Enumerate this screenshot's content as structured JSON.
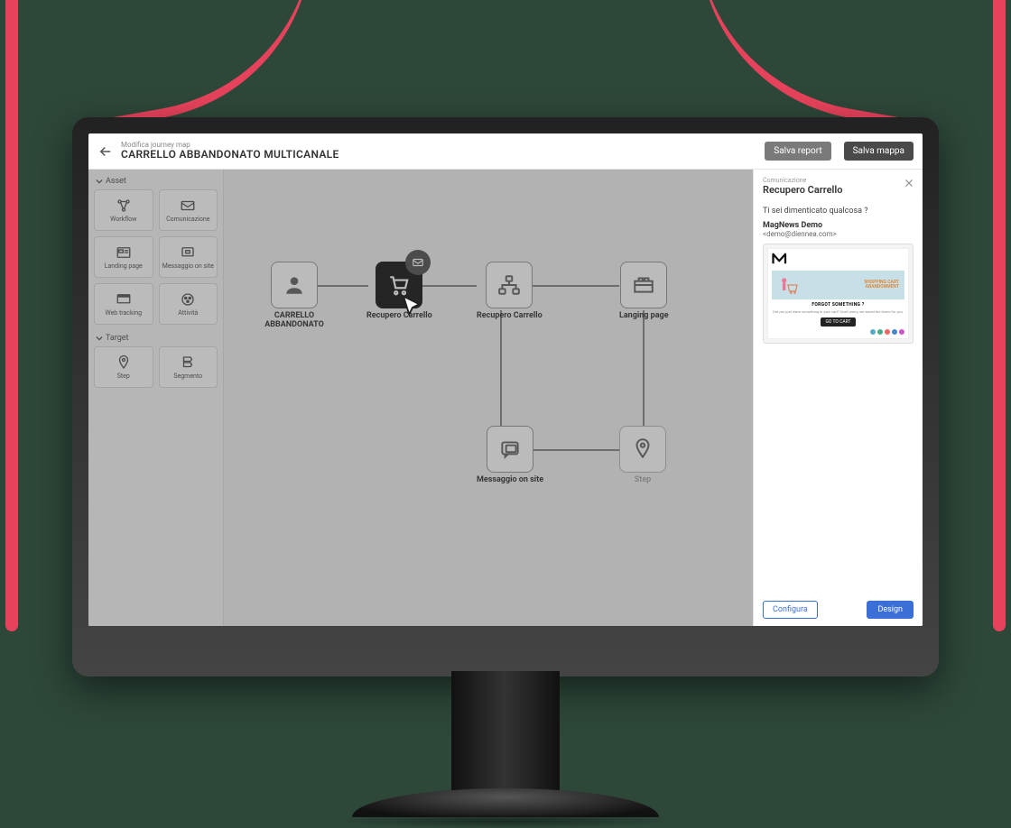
{
  "header": {
    "breadcrumb": "Modifica journey map",
    "title": "CARRELLO ABBANDONATO MULTICANALE",
    "save_report": "Salva report",
    "save_map": "Salva mappa"
  },
  "sidebar": {
    "sections": [
      {
        "title": "Asset",
        "tiles": [
          {
            "id": "workflow",
            "label": "Workflow"
          },
          {
            "id": "comunicazione",
            "label": "Comunicazione"
          },
          {
            "id": "landing",
            "label": "Landing page"
          },
          {
            "id": "msg-onsite",
            "label": "Messaggio on site"
          },
          {
            "id": "webtracking",
            "label": "Web tracking"
          },
          {
            "id": "attivita",
            "label": "Attività"
          }
        ]
      },
      {
        "title": "Target",
        "tiles": [
          {
            "id": "step",
            "label": "Step"
          },
          {
            "id": "segmento",
            "label": "Segmento"
          }
        ]
      }
    ]
  },
  "canvas": {
    "nodes": {
      "start": {
        "label": "CARRELLO ABBANDONATO"
      },
      "recupero1": {
        "label": "Recupero Carrello"
      },
      "recupero2": {
        "label": "Recupero Carrello"
      },
      "landing": {
        "label": "Langing page"
      },
      "msg": {
        "label": "Messaggio on site"
      },
      "step": {
        "label": "Step"
      }
    }
  },
  "panel": {
    "category": "Comunicazione",
    "title": "Recupero Carrello",
    "question": "Ti sei dimenticato qualcosa ?",
    "from_name": "MagNews Demo",
    "from_email": "<demo@diennea.com>",
    "preview": {
      "logo": "M",
      "banner_line1": "SHOPPING CART",
      "banner_line2": "ABANDONMENT",
      "headline": "FORGOT SOMETHING ?",
      "body_text": "Did you just leave something in your cart? Don't worry, we saved the items for you.",
      "cta": "GO TO CART"
    },
    "configure_btn": "Configura",
    "design_btn": "Design"
  }
}
